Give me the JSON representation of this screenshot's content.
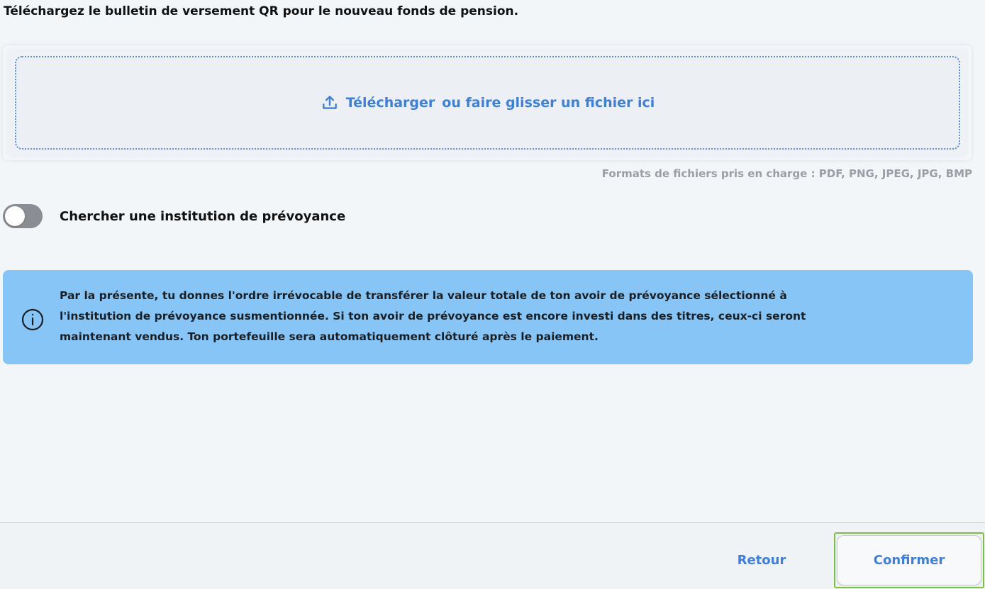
{
  "instruction": "Téléchargez le bulletin de versement QR pour le nouveau fonds de pension.",
  "dropzone": {
    "icon": "upload-icon",
    "link_text": "Télécharger",
    "rest_text": "ou faire glisser un fichier ici"
  },
  "formats_text": "Formats de fichiers pris en charge : PDF, PNG, JPEG, JPG, BMP",
  "toggle": {
    "label": "Chercher une institution de prévoyance",
    "checked": false
  },
  "info": {
    "icon": "info-icon",
    "lines": [
      "Par la présente, tu donnes l'ordre irrévocable de transférer la valeur totale de ton avoir de prévoyance sélectionné à",
      "l'institution de prévoyance susmentionnée. Si ton avoir de prévoyance est encore investi dans des titres, ceux-ci seront",
      "maintenant vendus. Ton portefeuille sera automatiquement clôturé après le paiement."
    ]
  },
  "footer": {
    "back_label": "Retour",
    "confirm_label": "Confirmer"
  },
  "colors": {
    "accent": "#3d7fe0",
    "info_bg": "#87c5f6",
    "toggle_off": "#8a8d93",
    "focus_ring": "#7bc043"
  }
}
